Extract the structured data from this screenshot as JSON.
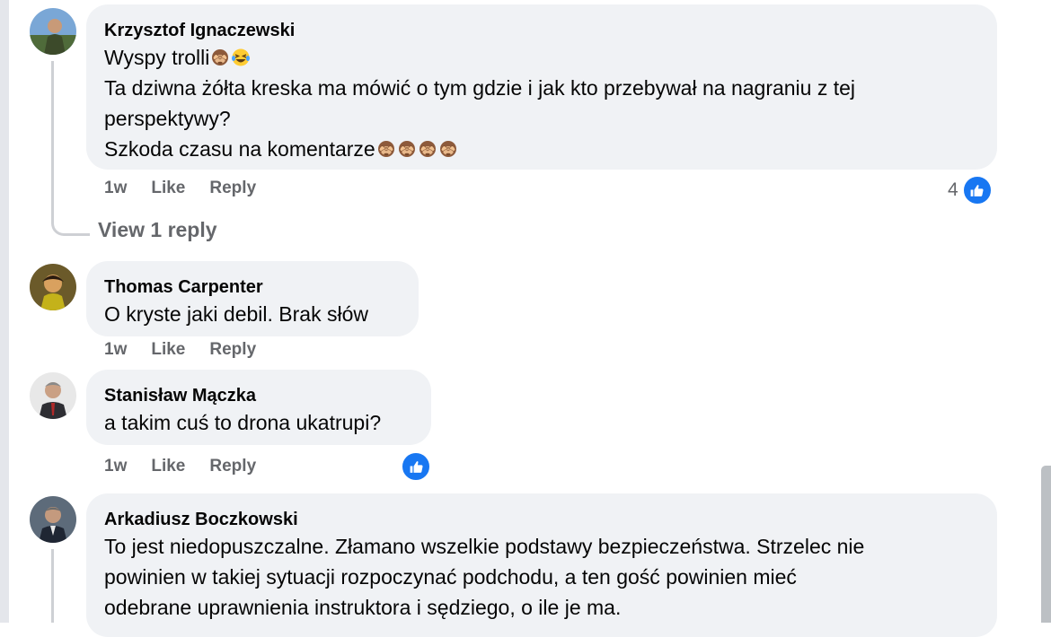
{
  "comments": [
    {
      "author": "Krzysztof Ignaczewski",
      "lines": [
        "Wyspy trolli",
        "Ta dziwna żółta kreska ma mówić o tym gdzie i jak kto przebywał na nagraniu z tej",
        "perspektywy?",
        "Szkoda czasu na komentarze"
      ],
      "emojis": [
        "see-no-evil-monkey",
        "laughing-tears",
        "see-no-evil-monkey x4"
      ],
      "time": "1w",
      "like_label": "Like",
      "reply_label": "Reply",
      "reaction_count": "4",
      "view_replies": "View 1 reply"
    },
    {
      "author": "Thomas Carpenter",
      "lines": [
        "O kryste jaki debil. Brak słów"
      ],
      "time": "1w",
      "like_label": "Like",
      "reply_label": "Reply"
    },
    {
      "author": "Stanisław Mączka",
      "lines": [
        "a takim cuś to drona ukatrupi?"
      ],
      "time": "1w",
      "like_label": "Like",
      "reply_label": "Reply"
    },
    {
      "author": "Arkadiusz Boczkowski",
      "lines": [
        "To jest niedopuszczalne. Złamano wszelkie podstawy bezpieczeństwa. Strzelec nie",
        "powinien w takiej sytuacji rozpoczynać podchodu, a ten gość powinien mieć",
        "odebrane uprawnienia instruktora i sędziego, o ile je ma."
      ]
    }
  ],
  "colors": {
    "bubble": "#f0f2f5",
    "meta_text": "#65676b",
    "like_blue": "#1877f2",
    "thread_line": "#ced0d4"
  }
}
